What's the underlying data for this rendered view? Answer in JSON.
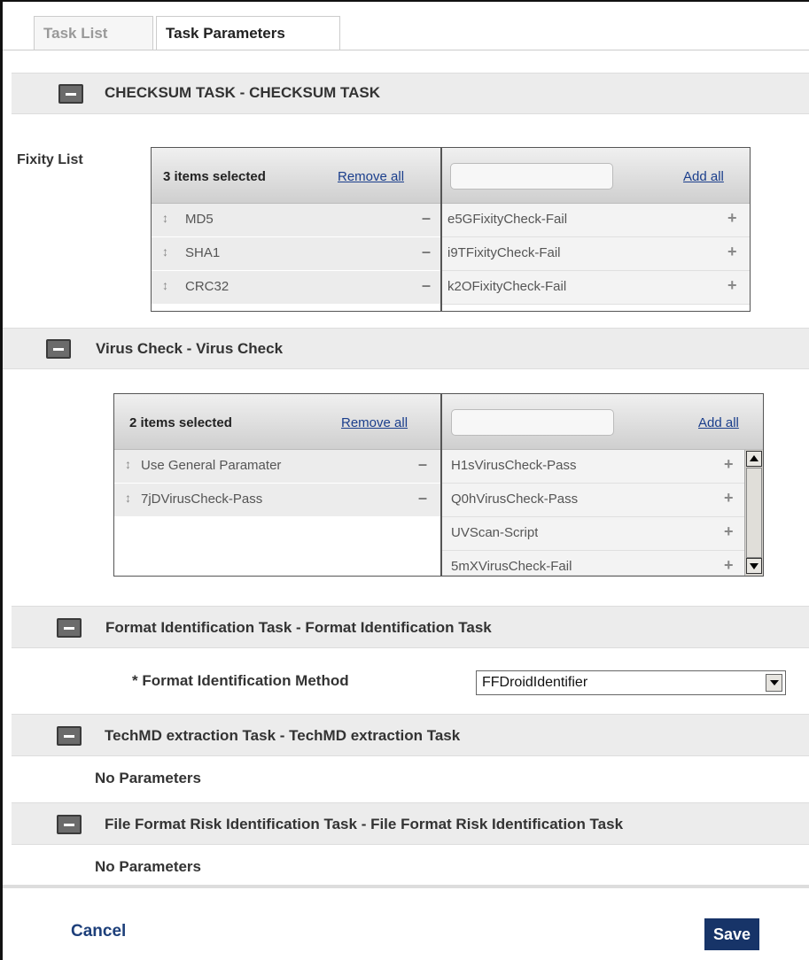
{
  "tabs": [
    {
      "label": "Task List"
    },
    {
      "label": "Task Parameters"
    }
  ],
  "checksum": {
    "title": "CHECKSUM TASK - CHECKSUM TASK",
    "field_label": "Fixity List",
    "selected_count": "3 items selected",
    "remove_all": "Remove all",
    "add_all": "Add all",
    "search_value": "",
    "selected": [
      "MD5",
      "SHA1",
      "CRC32"
    ],
    "available": [
      "e5GFixityCheck-Fail",
      "i9TFixityCheck-Fail",
      "k2OFixityCheck-Fail"
    ]
  },
  "virus": {
    "title": "Virus Check - Virus Check",
    "selected_count": "2 items selected",
    "remove_all": "Remove all",
    "add_all": "Add all",
    "search_value": "",
    "selected": [
      "Use General Paramater",
      "7jDVirusCheck-Pass"
    ],
    "available": [
      "H1sVirusCheck-Pass",
      "Q0hVirusCheck-Pass",
      "UVScan-Script",
      "5mXVirusCheck-Fail"
    ]
  },
  "format": {
    "title": "Format Identification Task - Format Identification Task",
    "field_label": "* Format Identification Method",
    "selected_value": "FFDroidIdentifier"
  },
  "techmd": {
    "title": "TechMD extraction Task - TechMD extraction Task",
    "no_params": "No Parameters"
  },
  "risk": {
    "title": "File Format Risk Identification Task - File Format Risk Identification Task",
    "no_params": "No Parameters"
  },
  "footer": {
    "cancel": "Cancel",
    "save": "Save"
  },
  "colors": {
    "save_bg": "#173468",
    "link": "#1a3e8c",
    "section_bg": "#ececec"
  }
}
